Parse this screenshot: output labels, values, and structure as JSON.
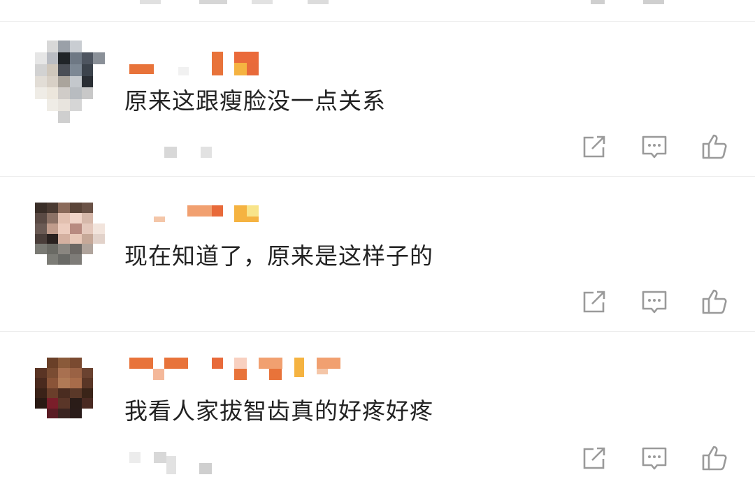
{
  "comments": [
    {
      "text": "原来这跟瘦脸没一点关系"
    },
    {
      "text": "现在知道了，原来是这样子的"
    },
    {
      "text": "我看人家拔智齿真的好疼好疼"
    }
  ],
  "actions": {
    "share_icon": "share-icon",
    "reply_icon": "comment-icon",
    "like_icon": "thumbs-up-icon"
  },
  "colors": {
    "name_orange": "#e8733a",
    "name_yellow": "#f5b341",
    "text": "#222222",
    "icon": "#9a9a9a",
    "divider": "#ececec"
  }
}
